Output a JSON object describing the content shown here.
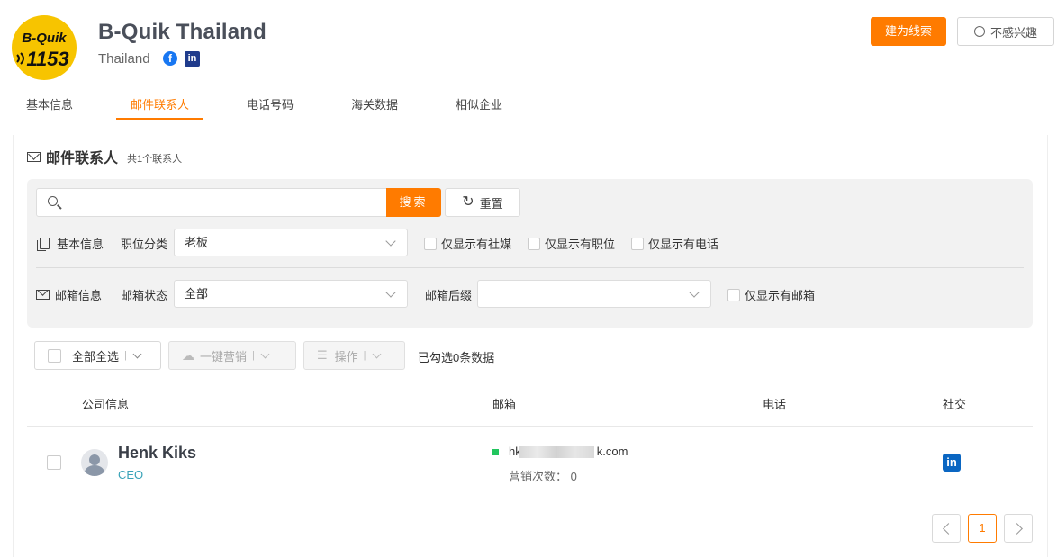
{
  "company": {
    "logo_line1": "B-Quik",
    "logo_line2": "1153",
    "name": "B-Quik Thailand",
    "country": "Thailand",
    "facebook_glyph": "f",
    "linkedin_glyph": "in"
  },
  "actions": {
    "create_lead": "建为线索",
    "not_interested": "不感兴趣"
  },
  "tabs": [
    {
      "label": "基本信息",
      "active": false
    },
    {
      "label": "邮件联系人",
      "active": true
    },
    {
      "label": "电话号码",
      "active": false
    },
    {
      "label": "海关数据",
      "active": false
    },
    {
      "label": "相似企业",
      "active": false
    }
  ],
  "section": {
    "title": "邮件联系人",
    "count": "共1个联系人"
  },
  "search": {
    "placeholder": "",
    "search_button": "搜索",
    "reset_button": "重置"
  },
  "filters": {
    "basic_info_label": "基本信息",
    "position_label": "职位分类",
    "position_value": "老板",
    "only_social": "仅显示有社媒",
    "only_position": "仅显示有职位",
    "only_phone": "仅显示有电话",
    "email_info_label": "邮箱信息",
    "email_status_label": "邮箱状态",
    "email_status_value": "全部",
    "email_suffix_label": "邮箱后缀",
    "email_suffix_value": "",
    "only_email": "仅显示有邮箱"
  },
  "toolbar": {
    "select_all": "全部全选",
    "one_click_marketing": "一键营销",
    "operations": "操作",
    "selected_count": "已勾选0条数据"
  },
  "table": {
    "headers": [
      "公司信息",
      "邮箱",
      "电话",
      "社交"
    ],
    "rows": [
      {
        "name": "Henk Kiks",
        "title": "CEO",
        "email_prefix": "hk",
        "email_suffix": "k.com",
        "marketing_count": "营销次数：  0",
        "email_status_color": "#22c55e",
        "social": "in"
      }
    ]
  },
  "pagination": {
    "current": "1"
  },
  "colors": {
    "accent": "#ff7b00",
    "logo_bg": "#f7c400",
    "linkedin": "#0a66c2",
    "title_teal": "#3aa3b8"
  }
}
